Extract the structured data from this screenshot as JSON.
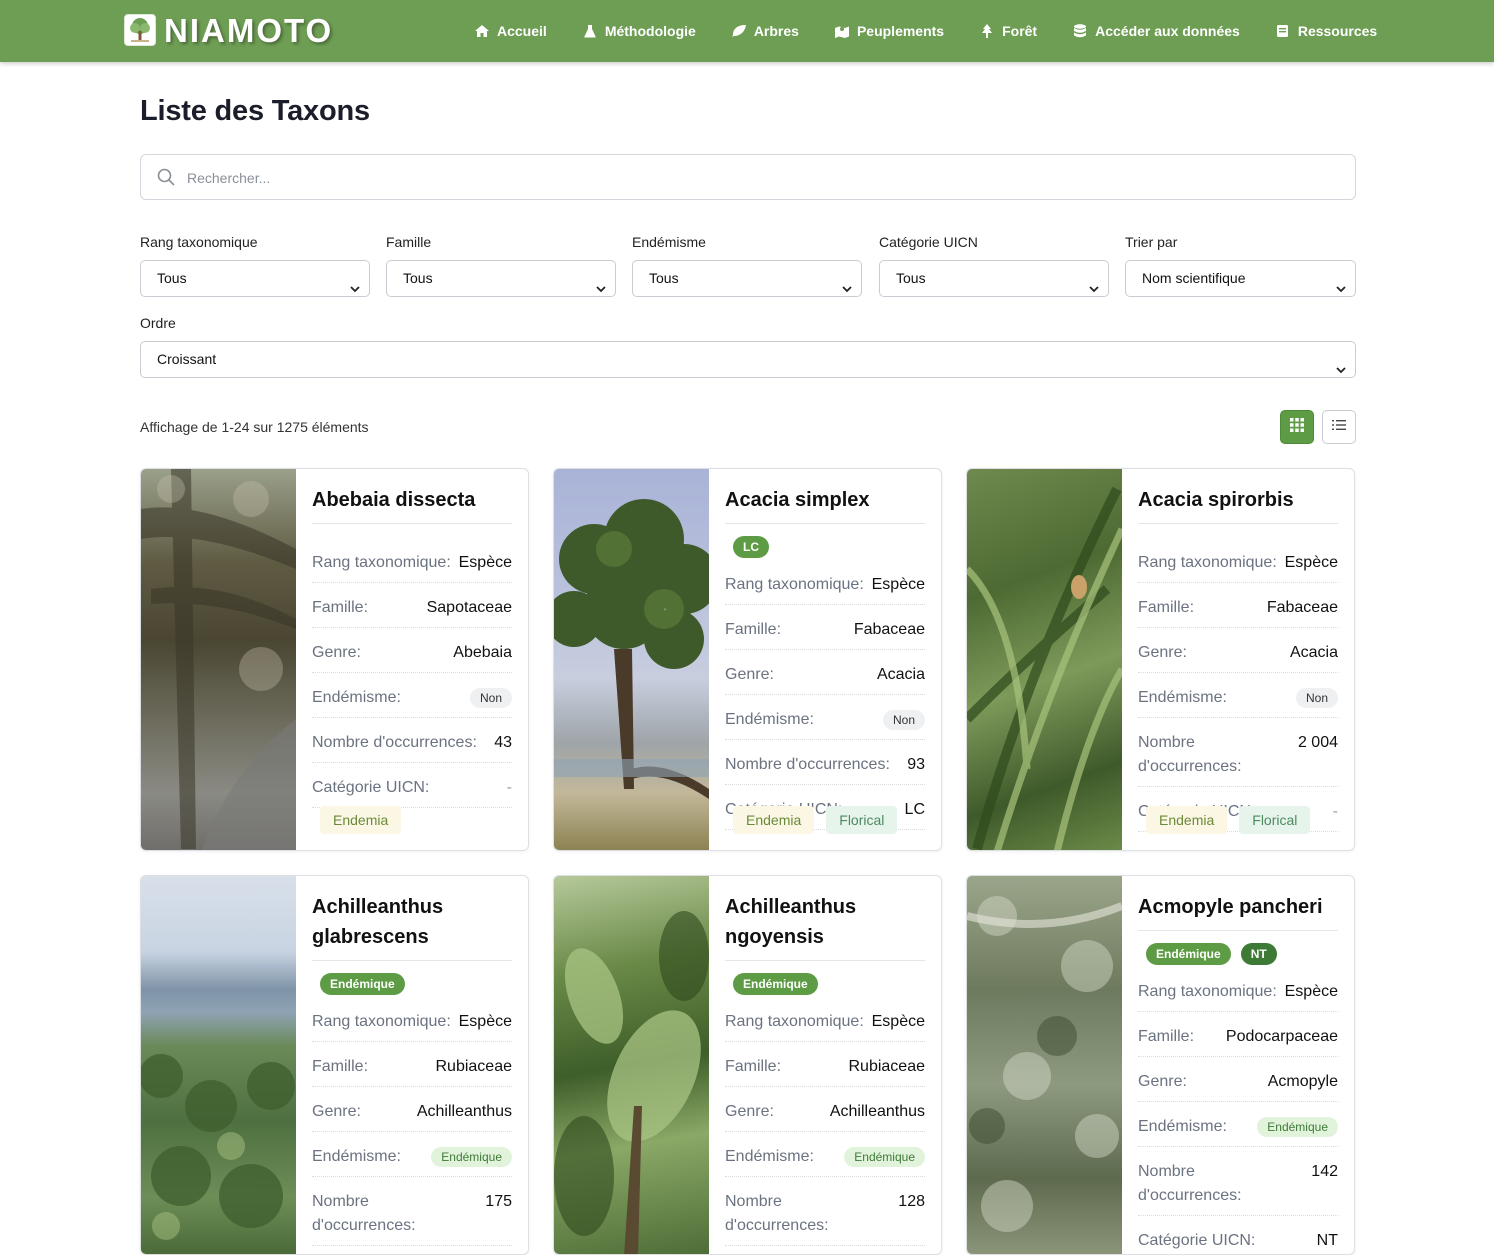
{
  "nav": {
    "brand": "NIAMOTO",
    "links": [
      {
        "label": "Accueil",
        "icon": "home-icon"
      },
      {
        "label": "Méthodologie",
        "icon": "flask-icon"
      },
      {
        "label": "Arbres",
        "icon": "leaf-icon"
      },
      {
        "label": "Peuplements",
        "icon": "map-icon"
      },
      {
        "label": "Forêt",
        "icon": "tree-icon"
      },
      {
        "label": "Accéder aux données",
        "icon": "database-icon"
      },
      {
        "label": "Ressources",
        "icon": "book-icon"
      }
    ]
  },
  "page": {
    "title": "Liste des Taxons"
  },
  "search": {
    "placeholder": "Rechercher..."
  },
  "filters": {
    "rank": {
      "label": "Rang taxonomique",
      "value": "Tous"
    },
    "family": {
      "label": "Famille",
      "value": "Tous"
    },
    "endemism": {
      "label": "Endémisme",
      "value": "Tous"
    },
    "iucn": {
      "label": "Catégorie UICN",
      "value": "Tous"
    },
    "sort": {
      "label": "Trier par",
      "value": "Nom scientifique"
    },
    "order": {
      "label": "Ordre",
      "value": "Croissant"
    }
  },
  "results": {
    "count_text": "Affichage de 1-24 sur 1275 éléments"
  },
  "labels": {
    "rank": "Rang taxonomique:",
    "family": "Famille:",
    "genus": "Genre:",
    "endemism": "Endémisme:",
    "occurrences": "Nombre d'occurrences:",
    "iucn": "Catégorie UICN:"
  },
  "cards": [
    {
      "name": "Abebaia dissecta",
      "rank": "Espèce",
      "family": "Sapotaceae",
      "genus": "Abebaia",
      "endemism": "Non",
      "occurrences": "43",
      "iucn": "-",
      "tags": [
        "Endemia"
      ]
    },
    {
      "name": "Acacia simplex",
      "badges": [
        "LC"
      ],
      "rank": "Espèce",
      "family": "Fabaceae",
      "genus": "Acacia",
      "endemism": "Non",
      "occurrences": "93",
      "iucn": "LC",
      "tags": [
        "Endemia",
        "Florical"
      ]
    },
    {
      "name": "Acacia spirorbis",
      "rank": "Espèce",
      "family": "Fabaceae",
      "genus": "Acacia",
      "endemism": "Non",
      "occurrences": "2 004",
      "iucn": "-",
      "tags": [
        "Endemia",
        "Florical"
      ]
    },
    {
      "name": "Achilleanthus glabrescens",
      "badges": [
        "Endémique"
      ],
      "rank": "Espèce",
      "family": "Rubiaceae",
      "genus": "Achilleanthus",
      "endemism": "Endémique",
      "occurrences": "175",
      "iucn": "-"
    },
    {
      "name": "Achilleanthus ngoyensis",
      "badges": [
        "Endémique"
      ],
      "rank": "Espèce",
      "family": "Rubiaceae",
      "genus": "Achilleanthus",
      "endemism": "Endémique",
      "occurrences": "128",
      "iucn": "-"
    },
    {
      "name": "Acmopyle pancheri",
      "badges": [
        "Endémique",
        "NT"
      ],
      "rank": "Espèce",
      "family": "Podocarpaceae",
      "genus": "Acmopyle",
      "endemism": "Endémique",
      "occurrences": "142",
      "iucn": "NT"
    }
  ]
}
